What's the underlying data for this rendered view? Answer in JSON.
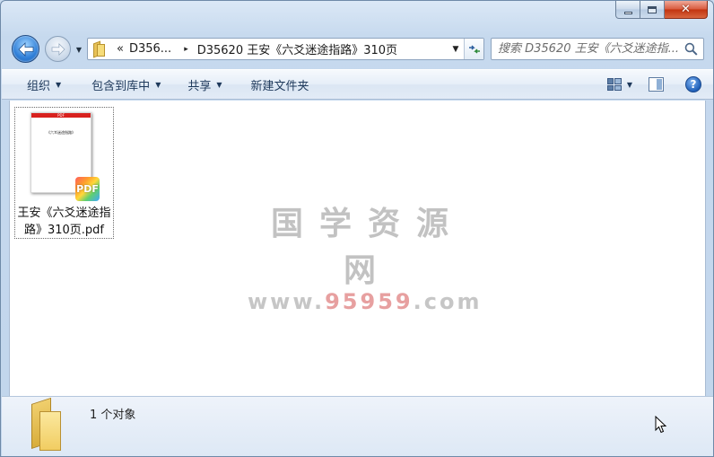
{
  "window": {
    "minimize_glyph": "",
    "maximize_glyph": "",
    "close_glyph": "✕"
  },
  "address_bar": {
    "overflow_glyph": "«",
    "crumbs": [
      "D356...",
      "D35620 王安《六爻迷途指路》310页"
    ],
    "separator_glyph": "▸"
  },
  "search": {
    "placeholder": "搜索 D35620 王安《六爻迷途指..."
  },
  "toolbar": {
    "organize": "组织",
    "include_in_library": "包含到库中",
    "share": "共享",
    "new_folder": "新建文件夹"
  },
  "files": [
    {
      "name": "王安《六爻迷途指路》310页.pdf",
      "thumb_header": "PDF",
      "thumb_title": "《六爻迷途指路》",
      "badge": "PDF"
    }
  ],
  "watermark": {
    "line1": "国学资源网",
    "line2_prefix": "www.",
    "line2_highlight": "95959",
    "line2_suffix": ".com"
  },
  "status": {
    "count_text": "1 个对象"
  },
  "icons": {
    "back": "back-arrow-icon",
    "forward": "forward-arrow-icon",
    "refresh": "refresh-icon",
    "search": "search-icon",
    "views": "change-view-icon",
    "preview": "preview-pane-icon",
    "help": "help-icon",
    "folder": "folder-icon",
    "pdf": "pdf-file-icon"
  },
  "colors": {
    "accent": "#1e395b",
    "window_frame": "#c1d5ec",
    "close_button": "#c2330f",
    "pdf_header": "#d8211e"
  }
}
